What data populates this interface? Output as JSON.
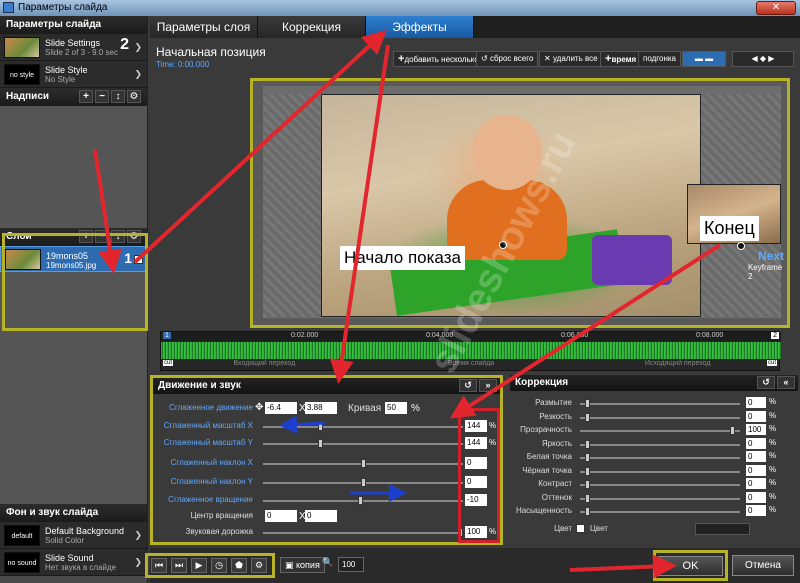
{
  "window": {
    "title": "Параметры слайда",
    "close_label": "✕"
  },
  "sidebar": {
    "slide_params_head": "Параметры слайда",
    "slide_settings": {
      "title": "Slide Settings",
      "sub": "Slide 2 of 3 - 9.0 sec",
      "num": "2"
    },
    "slide_style": {
      "thumb": "no style",
      "title": "Slide Style",
      "sub": "No Style"
    },
    "captions_head": "Надписи",
    "layers_head": "Слои",
    "layer": {
      "title": "19mons05",
      "sub": "19mons05.jpg",
      "num": "1"
    },
    "bg_head": "Фон и звук слайда",
    "bg": {
      "thumb": "default",
      "title": "Default Background",
      "sub": "Solid Color"
    },
    "sound": {
      "thumb": "no sound",
      "title": "Slide Sound",
      "sub": "Нет звука в слайде"
    }
  },
  "tabs": [
    "Параметры слоя",
    "Коррекция",
    "Эффекты"
  ],
  "main": {
    "pos_title": "Начальная позиция",
    "pos_time": "Time: 0:00.000",
    "btn_add_several": "добавить несколько",
    "btn_reset_all": "сброс всего",
    "btn_delete_all": "удалить все",
    "btn_time": "время",
    "btn_fit": "подгонка",
    "label_start": "Начало показа",
    "label_end": "Конец",
    "next_label": "Next",
    "keyframe_label": "Keyframe 2",
    "marker1": "1",
    "marker2": "2",
    "timeline": {
      "ticks": [
        "0:02.000",
        "0:04.000",
        "0:06.000",
        "0:08.000"
      ],
      "sections": [
        "Входящий переход",
        "Время слайда",
        "Исходящий переход"
      ],
      "cut": "cut"
    }
  },
  "motion": {
    "head": "Движение и звук",
    "smooth_move": "Сглаженное движение",
    "move_x": "-6.4",
    "move_y": "3.88",
    "curve_label": "Кривая",
    "curve_val": "50",
    "scale_x": "Сглаженный масштаб X",
    "scale_x_val": "144",
    "scale_y": "Сглаженный масштаб Y",
    "scale_y_val": "144",
    "tilt_x": "Сглаженный наклон X",
    "tilt_x_val": "0",
    "tilt_y": "Сглаженный наклон Y",
    "tilt_y_val": "0",
    "rotation": "Сглаженное вращение",
    "rotation_val": "-10",
    "rot_center": "Центр вращения",
    "rot_center_x": "0",
    "rot_center_y": "0",
    "audio": "Звуковая дорожка",
    "audio_val": "100",
    "pct": "%",
    "x": "X",
    "y": "Y"
  },
  "correction": {
    "head": "Коррекция",
    "rows": [
      {
        "label": "Размытие",
        "val": "0"
      },
      {
        "label": "Резкость",
        "val": "0"
      },
      {
        "label": "Прозрачность",
        "val": "100"
      },
      {
        "label": "Яркость",
        "val": "0"
      },
      {
        "label": "Белая точка",
        "val": "0"
      },
      {
        "label": "Чёрная точка",
        "val": "0"
      },
      {
        "label": "Контраст",
        "val": "0"
      },
      {
        "label": "Оттенок",
        "val": "0"
      },
      {
        "label": "Насыщенность",
        "val": "0"
      }
    ],
    "color_label": "Цвет",
    "color_check": "Цвет",
    "pct": "%"
  },
  "bottom": {
    "copy": "копия",
    "zoom": "100",
    "ok": "OK",
    "cancel": "Отмена"
  },
  "watermark": "slideshows.ru",
  "colors": {
    "accent": "#1e6fc2",
    "highlight_yellow": "#b7b327",
    "highlight_red": "#d0202a",
    "arrow_red": "#e3262e",
    "arrow_blue": "#1d3fcf"
  }
}
